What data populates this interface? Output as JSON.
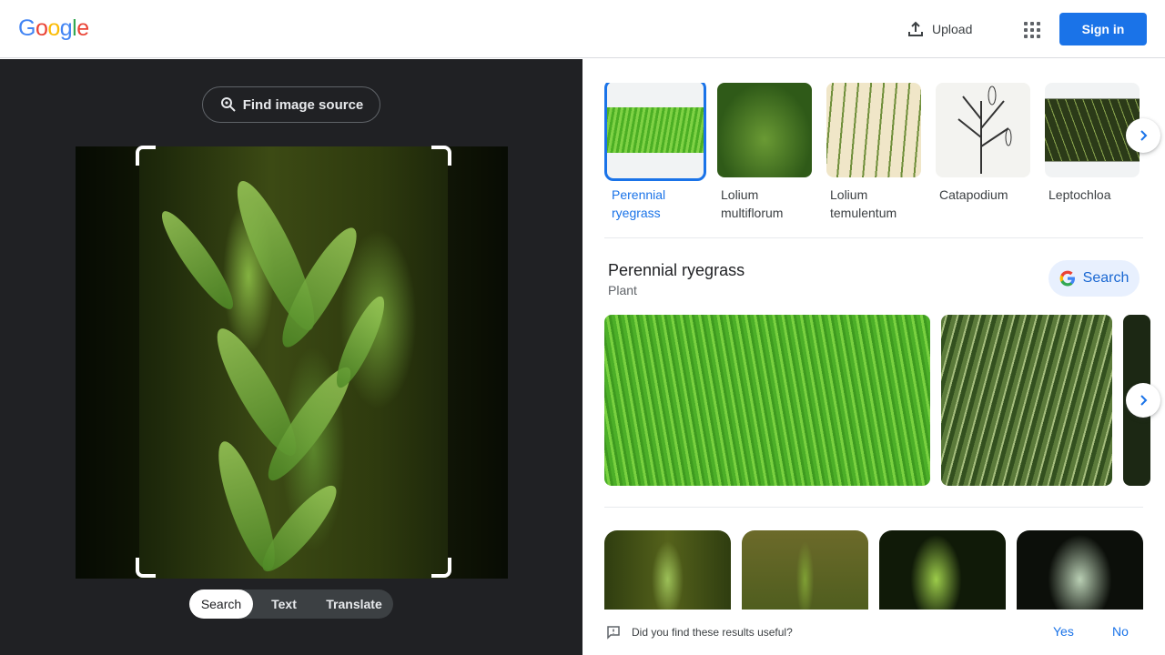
{
  "header": {
    "logo_letters": [
      {
        "ch": "G",
        "color": "#4285F4"
      },
      {
        "ch": "o",
        "color": "#EA4335"
      },
      {
        "ch": "o",
        "color": "#FBBC05"
      },
      {
        "ch": "g",
        "color": "#4285F4"
      },
      {
        "ch": "l",
        "color": "#34A853"
      },
      {
        "ch": "e",
        "color": "#EA4335"
      }
    ],
    "upload_label": "Upload",
    "apps_icon": "apps-grid-icon",
    "signin_label": "Sign in"
  },
  "left_panel": {
    "find_source_label": "Find image source",
    "modes": [
      "Search",
      "Text",
      "Translate"
    ],
    "active_mode": "Search"
  },
  "related_chips": [
    {
      "label": "Perennial ryegrass",
      "selected": true
    },
    {
      "label": "Lolium multiflorum",
      "selected": false
    },
    {
      "label": "Lolium temulentum",
      "selected": false
    },
    {
      "label": "Catapodium",
      "selected": false
    },
    {
      "label": "Leptochloa",
      "selected": false
    }
  ],
  "entity": {
    "title": "Perennial ryegrass",
    "subtitle": "Plant",
    "search_label": "Search"
  },
  "feedback": {
    "question": "Did you find these results useful?",
    "yes": "Yes",
    "no": "No"
  },
  "colors": {
    "brand_blue": "#1a73e8",
    "dark_panel": "#202124"
  }
}
